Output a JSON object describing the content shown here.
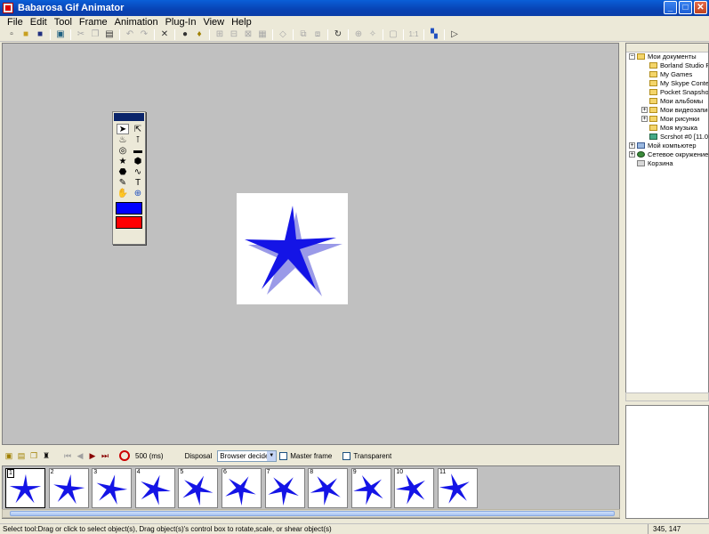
{
  "window": {
    "title": "Babarosa Gif Animator",
    "min": "_",
    "max": "□",
    "close": "✕"
  },
  "menu": [
    "File",
    "Edit",
    "Tool",
    "Frame",
    "Animation",
    "Plug-In",
    "View",
    "Help"
  ],
  "toolbar_icons": [
    "new-icon",
    "open-icon",
    "save-icon",
    "preview-icon",
    "cut-icon",
    "copy-icon",
    "paste-icon",
    "undo-icon",
    "redo-icon",
    "delete-icon",
    "flip-horizontal-icon",
    "flip-vertical-icon",
    "align-icon",
    "rotate-icon",
    "zoom-icon",
    "actual-size-icon",
    "play-icon"
  ],
  "colors": {
    "accent": "#0a246a",
    "primary_color": "#0000ff",
    "secondary_color": "#ff0000",
    "star": "#1414e6",
    "star_shadow": "#9a9ae8"
  },
  "toolbox": {
    "tools": [
      "select-arrow-icon",
      "direct-select-icon",
      "fill-icon",
      "eyedropper-icon",
      "ellipse-icon",
      "rectangle-icon",
      "star-icon",
      "polygon-icon",
      "blob-icon",
      "curve-icon",
      "pencil-icon",
      "text-icon",
      "hand-icon",
      "zoom-tool-icon"
    ],
    "text_tool": "T"
  },
  "tree": [
    {
      "label": "Мои документы",
      "expand": "−",
      "level": 0,
      "icon": "folder-icon"
    },
    {
      "label": "Borland Studio Pr",
      "level": 1,
      "icon": "folder-icon"
    },
    {
      "label": "My Games",
      "level": 1,
      "icon": "folder-icon"
    },
    {
      "label": "My Skype Conter",
      "level": 1,
      "icon": "folder-icon"
    },
    {
      "label": "Pocket Snapshot",
      "level": 1,
      "icon": "folder-icon"
    },
    {
      "label": "Мои альбомы",
      "level": 1,
      "icon": "folder-icon"
    },
    {
      "label": "Мои видеозапис",
      "expand": "+",
      "level": 1,
      "icon": "folder-icon"
    },
    {
      "label": "Мои рисунки",
      "expand": "+",
      "level": 1,
      "icon": "folder-icon"
    },
    {
      "label": "Моя музыка",
      "level": 1,
      "icon": "folder-icon"
    },
    {
      "label": "Scrshot #0 [11.02",
      "level": 1,
      "icon": "image-icon"
    },
    {
      "label": "Мой компьютер",
      "expand": "+",
      "level": 0,
      "icon": "computer-icon"
    },
    {
      "label": "Сетевое окружение",
      "expand": "+",
      "level": 0,
      "icon": "network-icon"
    },
    {
      "label": "Корзина",
      "level": 0,
      "icon": "trash-icon"
    }
  ],
  "frame_bar": {
    "delay": "500 (ms)",
    "disposal_label": "Disposal",
    "disposal_value": "Browser decide",
    "master_frame": "Master frame",
    "transparent": "Transparent"
  },
  "frames": [
    "1",
    "2",
    "3",
    "4",
    "5",
    "6",
    "7",
    "8",
    "9",
    "10",
    "11"
  ],
  "status": {
    "text": "Select tool:Drag or click to select object(s), Drag object(s)'s control box to rotate,scale, or shear object(s)",
    "coords": "345, 147"
  }
}
